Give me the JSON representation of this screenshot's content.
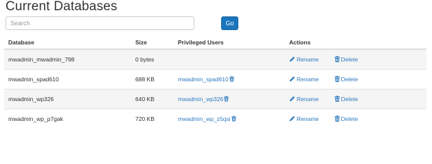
{
  "page": {
    "title": "Current Databases"
  },
  "search": {
    "placeholder": "Search",
    "value": "",
    "go_label": "Go"
  },
  "table": {
    "headers": {
      "database": "Database",
      "size": "Size",
      "users": "Privileged Users",
      "actions": "Actions"
    },
    "rows": [
      {
        "database": "mwadmin_mwadmin_798",
        "size": "0 bytes",
        "user": ""
      },
      {
        "database": "mwadmin_spad610",
        "size": "688 KB",
        "user": "mwadmin_spad610"
      },
      {
        "database": "mwadmin_wp326",
        "size": "640 KB",
        "user": "mwadmin_wp326"
      },
      {
        "database": "mwadmin_wp_p7gak",
        "size": "720 KB",
        "user": "mwadmin_wp_z5qsi"
      }
    ],
    "rename_label": "Rename",
    "delete_label": "Delete"
  },
  "icons": {
    "rename": "pencil-icon",
    "delete": "trash-icon",
    "remove_user": "trash-icon"
  },
  "colors": {
    "accent": "#1b75bc",
    "link": "#2f7bbf",
    "row_alt": "#f5f5f5"
  }
}
